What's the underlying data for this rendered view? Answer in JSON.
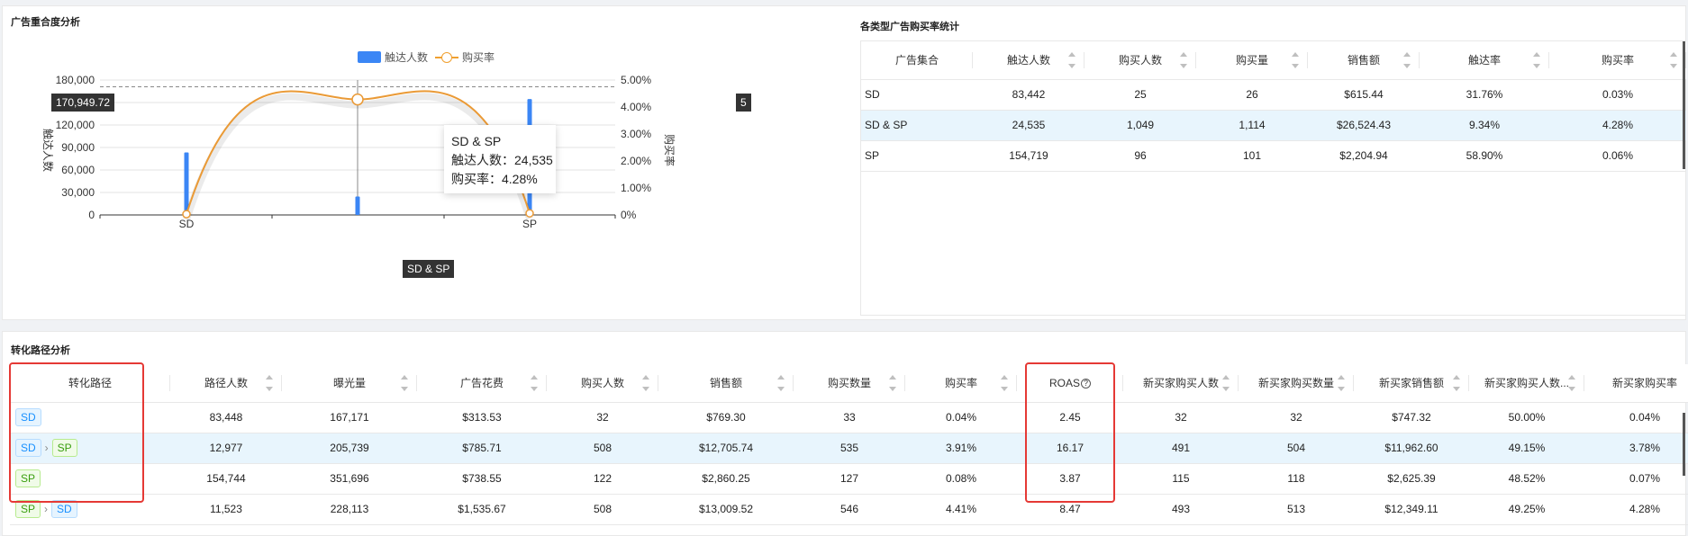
{
  "overlap": {
    "title": "广告重合度分析",
    "legend": {
      "bar": "触达人数",
      "line": "购买率"
    },
    "tooltip": {
      "title": "SD & SP",
      "reach_label": "触达人数：",
      "reach_value": "24,535",
      "rate_label": "购买率：",
      "rate_value": "4.28%"
    },
    "y_marker": "170,949.72",
    "y2_marker": "5",
    "x_marker": "SD & SP"
  },
  "chart_data": {
    "type": "bar",
    "categories": [
      "SD",
      "SD & SP",
      "SP"
    ],
    "series": [
      {
        "name": "触达人数",
        "type": "bar",
        "axis": "left",
        "values": [
          83442,
          24535,
          154719
        ]
      },
      {
        "name": "购买率",
        "type": "line",
        "axis": "right",
        "values": [
          0.03,
          4.28,
          0.06
        ]
      }
    ],
    "ylabel": "触达人数",
    "y2label": "购买率",
    "ylim": [
      0,
      180000
    ],
    "y2lim": [
      0,
      5
    ],
    "yticks": [
      "0",
      "30,000",
      "60,000",
      "90,000",
      "120,000",
      "150,000",
      "180,000"
    ],
    "y2ticks": [
      "0%",
      "1.00%",
      "2.00%",
      "3.00%",
      "4.00%",
      "5.00%"
    ],
    "grid": true,
    "legend": "top-center",
    "colors": {
      "bar": "#3b86f5",
      "line": "#ea9a36"
    }
  },
  "stats": {
    "title": "各类型广告购买率统计",
    "columns": [
      "广告集合",
      "触达人数",
      "购买人数",
      "购买量",
      "销售额",
      "触达率",
      "购买率"
    ],
    "rows": [
      [
        "SD",
        "83,442",
        "25",
        "26",
        "$615.44",
        "31.76%",
        "0.03%"
      ],
      [
        "SD & SP",
        "24,535",
        "1,049",
        "1,114",
        "$26,524.43",
        "9.34%",
        "4.28%"
      ],
      [
        "SP",
        "154,719",
        "96",
        "101",
        "$2,204.94",
        "58.90%",
        "0.06%"
      ]
    ]
  },
  "paths": {
    "title": "转化路径分析",
    "columns": [
      "转化路径",
      "路径人数",
      "曝光量",
      "广告花费",
      "购买人数",
      "销售额",
      "购买数量",
      "购买率",
      "ROAS",
      "新买家购买人数",
      "新买家购买数量",
      "新买家销售额",
      "新买家购买人数...",
      "新买家购买率"
    ],
    "rows": [
      {
        "path": [
          "SD"
        ],
        "cells": [
          "83,448",
          "167,171",
          "$313.53",
          "32",
          "$769.30",
          "33",
          "0.04%",
          "2.45",
          "32",
          "32",
          "$747.32",
          "50.00%",
          "0.04%"
        ]
      },
      {
        "path": [
          "SD",
          "SP"
        ],
        "cells": [
          "12,977",
          "205,739",
          "$785.71",
          "508",
          "$12,705.74",
          "535",
          "3.91%",
          "16.17",
          "491",
          "504",
          "$11,962.60",
          "49.15%",
          "3.78%"
        ]
      },
      {
        "path": [
          "SP"
        ],
        "cells": [
          "154,744",
          "351,696",
          "$738.55",
          "122",
          "$2,860.25",
          "127",
          "0.08%",
          "3.87",
          "115",
          "118",
          "$2,625.39",
          "48.52%",
          "0.07%"
        ]
      },
      {
        "path": [
          "SP",
          "SD"
        ],
        "cells": [
          "11,523",
          "228,113",
          "$1,535.67",
          "508",
          "$13,009.52",
          "546",
          "4.41%",
          "8.47",
          "493",
          "513",
          "$12,349.11",
          "49.25%",
          "4.28%"
        ]
      }
    ],
    "arrow": "›",
    "help_icon": "?"
  }
}
